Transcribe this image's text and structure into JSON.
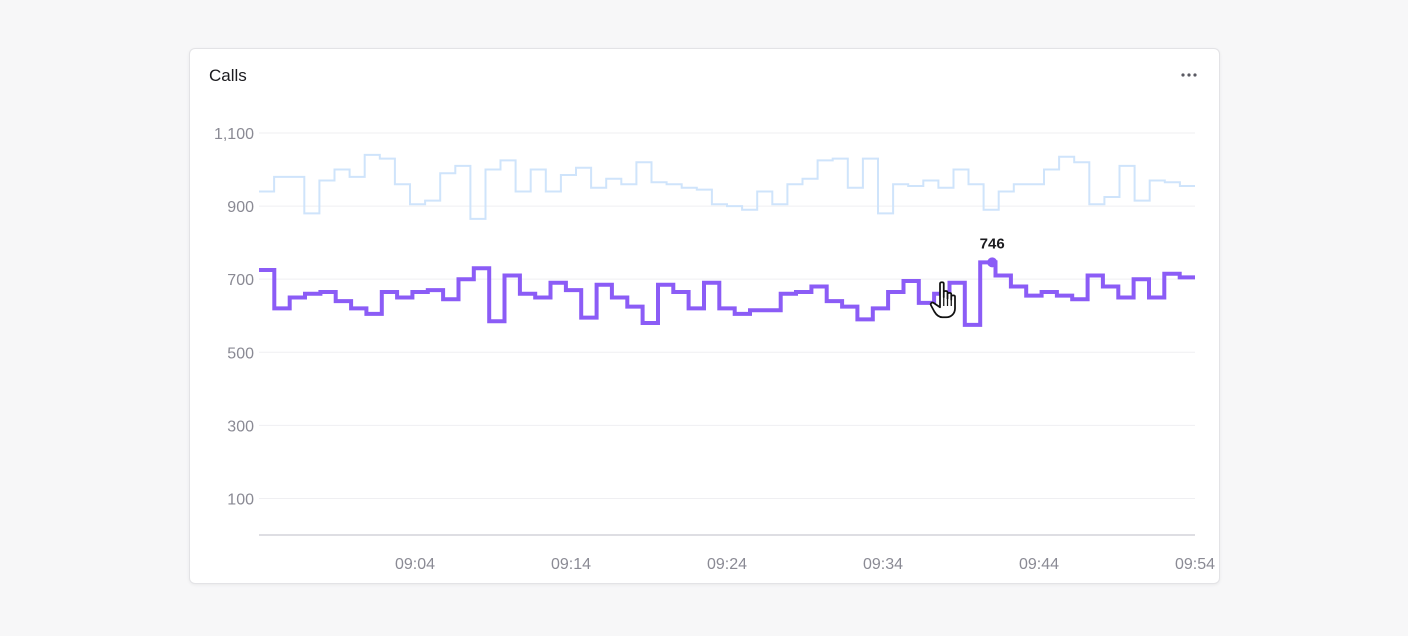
{
  "card": {
    "title": "Calls",
    "menu_icon": "more-horizontal-icon"
  },
  "colors": {
    "primary_series": "#8b5cf6",
    "secondary_series": "#cfe4fb",
    "gridline": "#efeff2",
    "axis_text": "#8a8a94",
    "baseline": "#dedee3"
  },
  "tooltip": {
    "value": "746"
  },
  "chart_data": {
    "type": "line",
    "step": true,
    "title": "Calls",
    "xlabel": "",
    "ylabel": "",
    "ylim": [
      0,
      1100
    ],
    "y_ticks": [
      100,
      300,
      500,
      700,
      900,
      1100
    ],
    "y_tick_labels": [
      "100",
      "300",
      "500",
      "700",
      "900",
      "1,100"
    ],
    "x_ticks": [
      "09:04",
      "09:14",
      "09:24",
      "09:34",
      "09:44",
      "09:54"
    ],
    "x_range_minutes": [
      0,
      60
    ],
    "grid": true,
    "legend": "none",
    "highlight": {
      "x": 47,
      "y": 746
    },
    "series": [
      {
        "values": [
          940,
          980,
          980,
          880,
          970,
          1000,
          980,
          1040,
          1030,
          960,
          905,
          915,
          990,
          1010,
          865,
          1000,
          1025,
          940,
          1000,
          940,
          985,
          1005,
          950,
          975,
          960,
          1020,
          965,
          960,
          950,
          945,
          905,
          900,
          890,
          940,
          905,
          960,
          975,
          1025,
          1030,
          950,
          1030,
          880,
          960,
          955,
          970,
          950,
          1000,
          960,
          890,
          940,
          960,
          960,
          1000,
          1035,
          1020,
          905,
          925,
          1010,
          915,
          970,
          965,
          955
        ]
      },
      {
        "values": [
          725,
          620,
          650,
          660,
          665,
          640,
          620,
          605,
          665,
          650,
          665,
          670,
          645,
          700,
          730,
          585,
          710,
          660,
          650,
          690,
          670,
          595,
          685,
          650,
          625,
          580,
          685,
          665,
          620,
          690,
          620,
          605,
          615,
          615,
          660,
          665,
          680,
          640,
          625,
          590,
          620,
          665,
          695,
          635,
          660,
          690,
          575,
          746,
          710,
          680,
          655,
          665,
          655,
          645,
          710,
          680,
          650,
          700,
          650,
          715,
          705
        ]
      }
    ]
  }
}
